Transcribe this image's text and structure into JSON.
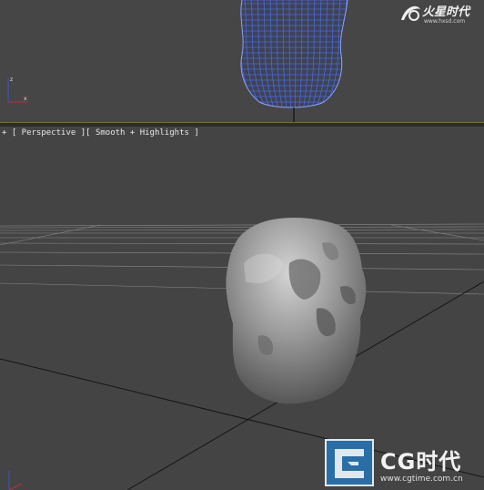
{
  "top_viewport": {
    "watermark": {
      "brand": "火星时代",
      "url": "www.hxsd.com"
    }
  },
  "bottom_viewport": {
    "label": "+ [ Perspective ][ Smooth + Highlights ]",
    "watermark": {
      "brand": "CG时代",
      "url": "www.cgtime.com.cn"
    }
  },
  "colors": {
    "viewport_bg": "#444444",
    "active_border": "#7a6a3a",
    "wireframe": "#4a6ad8"
  }
}
